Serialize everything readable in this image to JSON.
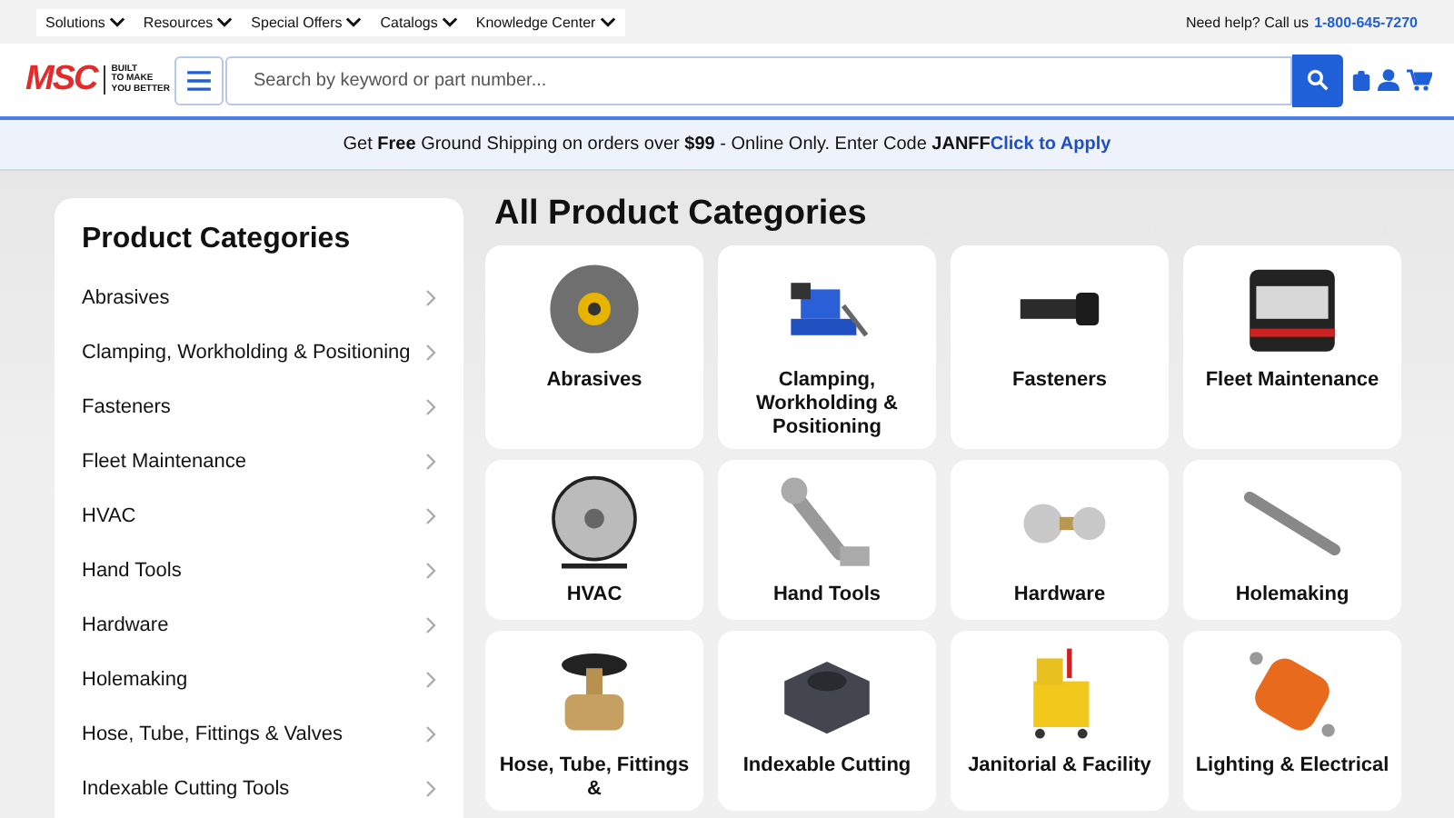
{
  "top_nav": {
    "items": [
      {
        "label": "Solutions"
      },
      {
        "label": "Resources"
      },
      {
        "label": "Special Offers"
      },
      {
        "label": "Catalogs"
      },
      {
        "label": "Knowledge Center"
      }
    ],
    "help_text": "Need help? Call us",
    "phone": "1-800-645-7270"
  },
  "header": {
    "logo": {
      "mark": "MSC",
      "tagline": [
        "BUILT",
        "TO MAKE",
        "YOU BETTER"
      ]
    },
    "search": {
      "placeholder": "Search by keyword or part number..."
    }
  },
  "promo": {
    "text": "Get **Free** Ground Shipping on orders over **$99** - Online Only. Enter Code **JANFF**",
    "link": "Click to Apply"
  },
  "sidebar": {
    "title": "Product Categories",
    "items": [
      "Abrasives",
      "Clamping, Workholding & Positioning",
      "Fasteners",
      "Fleet Maintenance",
      "HVAC",
      "Hand Tools",
      "Hardware",
      "Holemaking",
      "Hose, Tube, Fittings & Valves",
      "Indexable Cutting Tools"
    ]
  },
  "main": {
    "title": "All Product Categories",
    "cards": [
      {
        "label": "Abrasives"
      },
      {
        "label": "Clamping, Workholding & Positioning"
      },
      {
        "label": "Fasteners"
      },
      {
        "label": "Fleet Maintenance"
      },
      {
        "label": "HVAC"
      },
      {
        "label": "Hand Tools"
      },
      {
        "label": "Hardware"
      },
      {
        "label": "Holemaking"
      },
      {
        "label": "Hose, Tube, Fittings &"
      },
      {
        "label": "Indexable Cutting"
      },
      {
        "label": "Janitorial & Facility"
      },
      {
        "label": "Lighting & Electrical"
      }
    ]
  }
}
